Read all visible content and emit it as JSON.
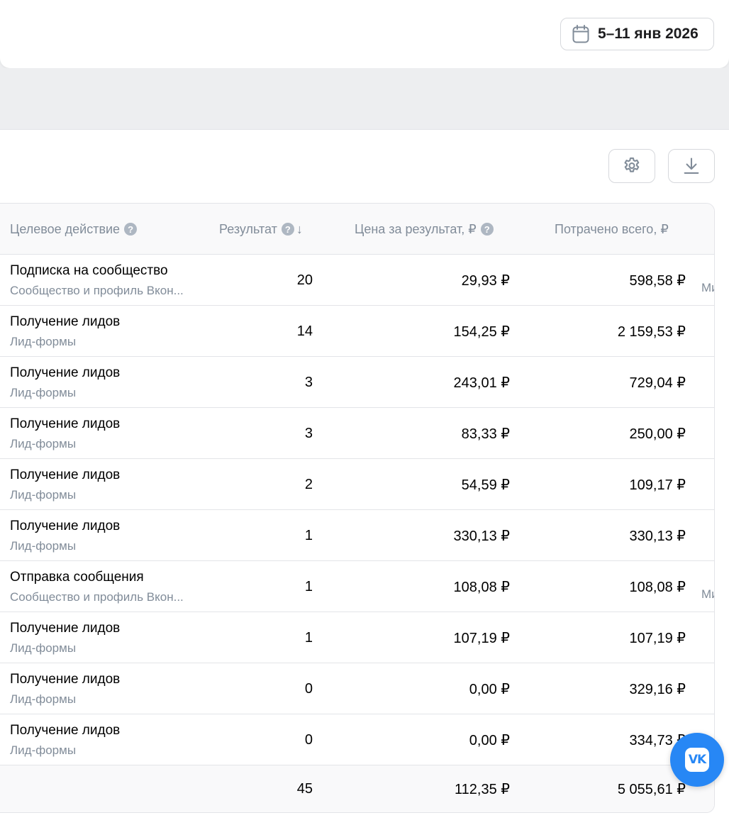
{
  "header": {
    "date_range": "5–11 янв 2026"
  },
  "toolbar": {
    "settings_icon": "gear-icon",
    "download_icon": "download-icon"
  },
  "table": {
    "columns": {
      "action": "Целевое действие",
      "result": "Результат",
      "price": "Цена за результат, ₽",
      "spent": "Потрачено всего, ₽"
    },
    "rows": [
      {
        "title": "Подписка на сообщество",
        "sub": "Сообщество и профиль Вкон...",
        "result": "20",
        "price": "29,93 ₽",
        "spent": "598,58 ₽",
        "side": "Ми"
      },
      {
        "title": "Получение лидов",
        "sub": "Лид-формы",
        "result": "14",
        "price": "154,25 ₽",
        "spent": "2 159,53 ₽",
        "side": ""
      },
      {
        "title": "Получение лидов",
        "sub": "Лид-формы",
        "result": "3",
        "price": "243,01 ₽",
        "spent": "729,04 ₽",
        "side": ""
      },
      {
        "title": "Получение лидов",
        "sub": "Лид-формы",
        "result": "3",
        "price": "83,33 ₽",
        "spent": "250,00 ₽",
        "side": ""
      },
      {
        "title": "Получение лидов",
        "sub": "Лид-формы",
        "result": "2",
        "price": "54,59 ₽",
        "spent": "109,17 ₽",
        "side": ""
      },
      {
        "title": "Получение лидов",
        "sub": "Лид-формы",
        "result": "1",
        "price": "330,13 ₽",
        "spent": "330,13 ₽",
        "side": ""
      },
      {
        "title": "Отправка сообщения",
        "sub": "Сообщество и профиль Вкон...",
        "result": "1",
        "price": "108,08 ₽",
        "spent": "108,08 ₽",
        "side": "Ми"
      },
      {
        "title": "Получение лидов",
        "sub": "Лид-формы",
        "result": "1",
        "price": "107,19 ₽",
        "spent": "107,19 ₽",
        "side": ""
      },
      {
        "title": "Получение лидов",
        "sub": "Лид-формы",
        "result": "0",
        "price": "0,00 ₽",
        "spent": "329,16 ₽",
        "side": ""
      },
      {
        "title": "Получение лидов",
        "sub": "Лид-формы",
        "result": "0",
        "price": "0,00 ₽",
        "spent": "334,73 ₽",
        "side": ""
      }
    ],
    "totals": {
      "result": "45",
      "price": "112,35 ₽",
      "spent": "5 055,61 ₽"
    }
  },
  "fab": {
    "label": "VK"
  },
  "colors": {
    "accent": "#2787f5",
    "muted_text": "#818c99",
    "border": "#e3e4e8"
  }
}
